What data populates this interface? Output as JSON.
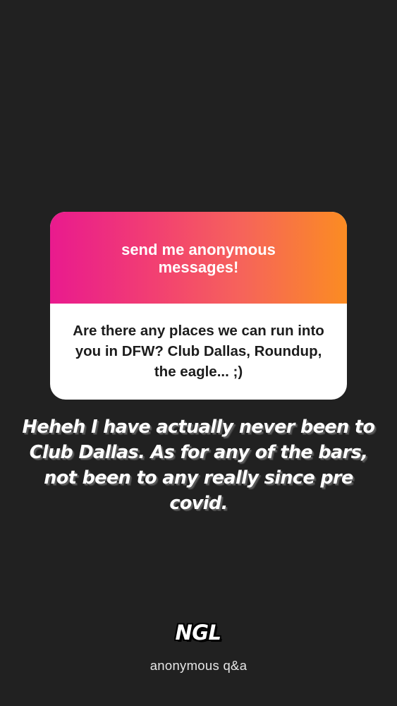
{
  "card": {
    "header_text": "send me anonymous messages!",
    "question": "Are there any places we can run into you in DFW? Club Dallas, Roundup, the eagle... ;)",
    "gradient_colors": [
      "#e91a8e",
      "#fb8c22"
    ]
  },
  "answer": {
    "text": "Heheh I have actually never been to Club Dallas. As for any of the bars, not been to any really since pre covid."
  },
  "branding": {
    "logo_text": "NGL",
    "tagline": "anonymous q&a"
  },
  "colors": {
    "background": "#212121",
    "card_body": "#ffffff",
    "answer_text": "#ffffff"
  }
}
